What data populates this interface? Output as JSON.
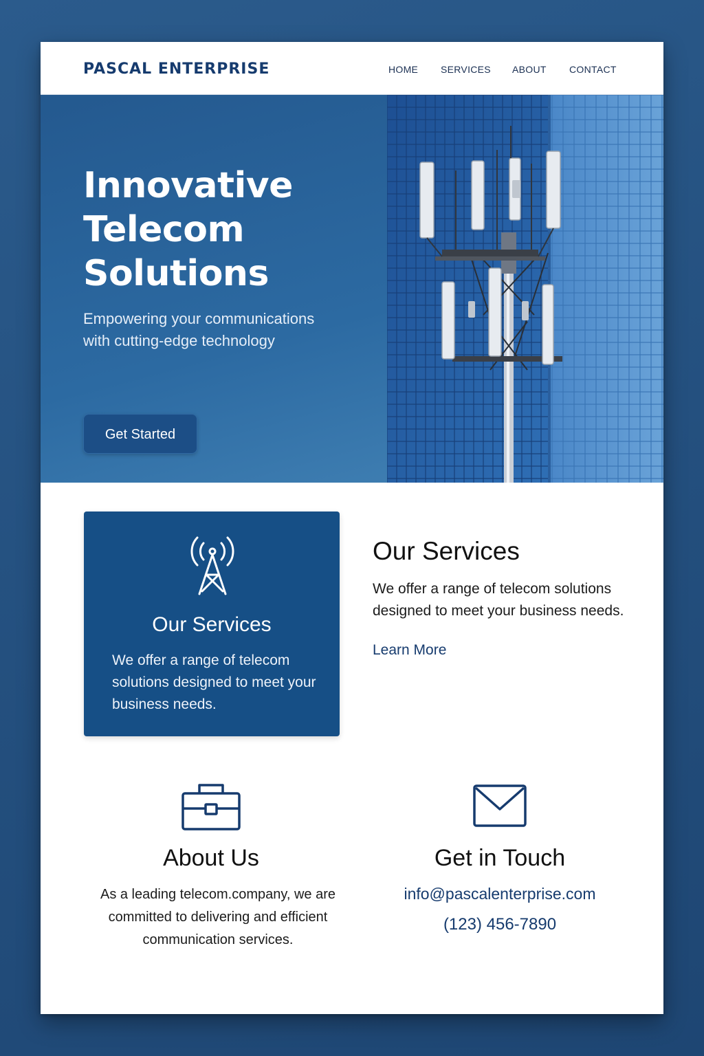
{
  "header": {
    "brand": "PASCAL ENTERPRISE",
    "nav": [
      "HOME",
      "SERVICES",
      "ABOUT",
      "CONTACT"
    ]
  },
  "hero": {
    "title": "Innovative Telecom Solutions",
    "subtitle": "Empowering your communications with cutting-edge technology",
    "cta_label": "Get Started",
    "image_icon": "cell-tower-on-glass-building-photo"
  },
  "services": {
    "card": {
      "icon": "antenna-tower-icon",
      "title": "Our Services",
      "text": "We offer a range of telecom solutions designed to meet your business needs."
    },
    "title": "Our Services",
    "text": "We offer a range of telecom solutions designed to meet your business needs.",
    "link_label": "Learn More"
  },
  "about": {
    "icon": "briefcase-icon",
    "title": "About Us",
    "text": "As a leading telecom.company, we are committed to delivering and efficient communication services."
  },
  "contact": {
    "icon": "envelope-icon",
    "title": "Get in Touch",
    "email": "info@pascalenterprise.com",
    "phone": "(123) 456-7890"
  },
  "colors": {
    "brand": "#163b6e",
    "hero_gradient_start": "#24598f",
    "hero_gradient_end": "#4585b7",
    "card_background": "#164f86",
    "button": "#1c4e86"
  }
}
